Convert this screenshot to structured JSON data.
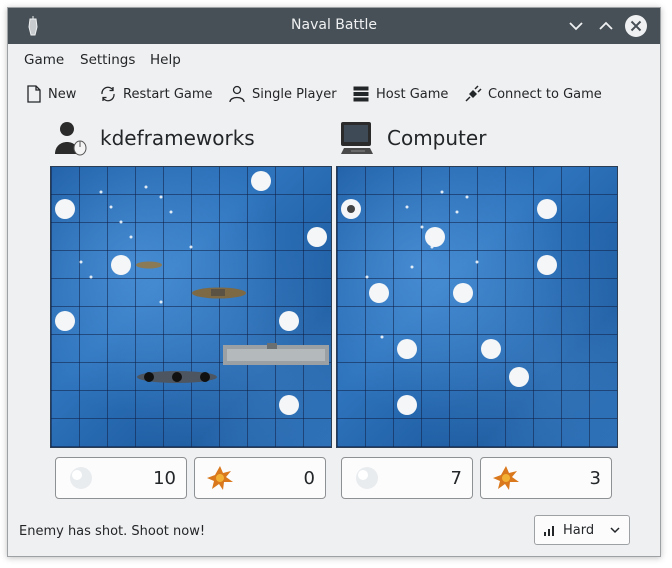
{
  "window": {
    "title": "Naval Battle"
  },
  "menubar": {
    "items": [
      "Game",
      "Settings",
      "Help"
    ]
  },
  "toolbar": {
    "new_label": "New",
    "restart_label": "Restart Game",
    "single_label": "Single Player",
    "host_label": "Host Game",
    "connect_label": "Connect to Game"
  },
  "players": [
    {
      "name": "kdeframeworks",
      "icon": "user-icon",
      "shots_missed": "10",
      "shots_hit": "0"
    },
    {
      "name": "Computer",
      "icon": "computer-icon",
      "shots_missed": "7",
      "shots_hit": "3"
    }
  ],
  "status": {
    "message": "Enemy has shot. Shoot now!"
  },
  "difficulty": {
    "selected": "Hard"
  },
  "colors": {
    "titlebar": "#475057",
    "window_bg": "#eff0f1",
    "sea": "#2e74bd",
    "grid": "#10204a"
  }
}
